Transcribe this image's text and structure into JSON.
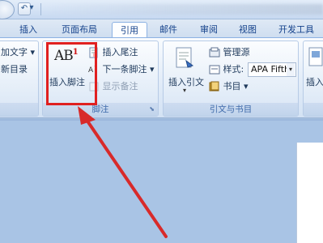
{
  "tabs": [
    "插入",
    "页面布局",
    "引用",
    "邮件",
    "审阅",
    "视图",
    "开发工具"
  ],
  "active_tab": "引用",
  "toc_group": {
    "add_text": "加文字 ▾",
    "update_toc": "新目录"
  },
  "footnote_group": {
    "label": "脚注",
    "insert_footnote": "插入脚注",
    "ab_glyph": "AB",
    "superscript": "1",
    "insert_endnote": "插入尾注",
    "next_footnote": "下一条脚注 ▾",
    "show_notes": "显示备注"
  },
  "citation_group": {
    "label": "引文与书目",
    "insert_citation": "插入引文",
    "manage_sources": "管理源",
    "style_label": "样式:",
    "style_value": "APA Fifth",
    "bibliography": "书目 ▾"
  },
  "right_group": {
    "insert_label": "插入"
  },
  "colors": {
    "highlight": "#e02020",
    "arrow": "#d82a2a"
  }
}
